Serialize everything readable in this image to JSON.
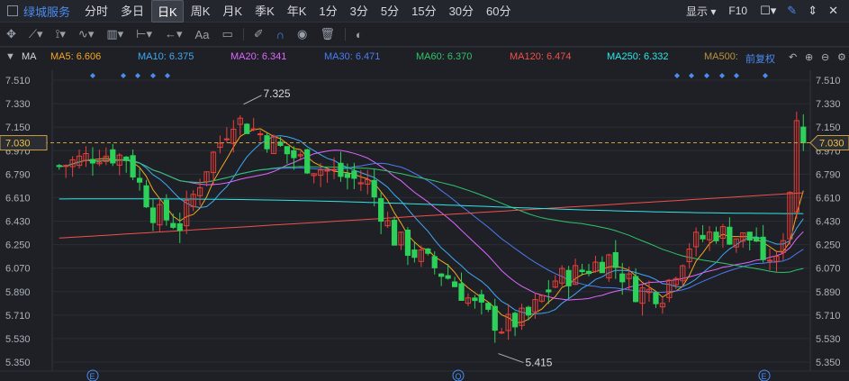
{
  "topbar": {
    "stock_name": "绿城服务",
    "periods": [
      "分时",
      "多日",
      "日K",
      "周K",
      "月K",
      "季K",
      "年K",
      "1分",
      "3分",
      "5分",
      "15分",
      "30分",
      "60分"
    ],
    "active_period": "日K",
    "display_label": "显示",
    "f10_label": "F10"
  },
  "toolbar": {
    "text_tool": "Aa"
  },
  "ma_bar": {
    "toggle_label": "MA",
    "items": [
      {
        "label": "MA5: 6.606",
        "color": "#f5a623"
      },
      {
        "label": "MA10: 6.375",
        "color": "#3fa9f5"
      },
      {
        "label": "MA20: 6.341",
        "color": "#e066ff"
      },
      {
        "label": "MA30: 6.471",
        "color": "#4a7df0"
      },
      {
        "label": "MA60: 6.370",
        "color": "#30c46a"
      },
      {
        "label": "MA120: 6.474",
        "color": "#f0504a"
      },
      {
        "label": "MA250: 6.332",
        "color": "#2ee6e6"
      },
      {
        "label": "MA500: ",
        "color": "#b8923a"
      }
    ],
    "adjust_label": "前复权"
  },
  "price_axis": [
    "7.510",
    "7.330",
    "7.150",
    "6.970",
    "6.790",
    "6.610",
    "6.430",
    "6.250",
    "6.070",
    "5.890",
    "5.710",
    "5.530",
    "5.350"
  ],
  "current_price": "7.030",
  "annotations": {
    "high": "7.325",
    "low": "5.415"
  },
  "event_markers": [
    "E",
    "Q",
    "E"
  ],
  "colors": {
    "up": "#e8403a",
    "down": "#2dd159",
    "dashed": "#c8a040"
  }
}
